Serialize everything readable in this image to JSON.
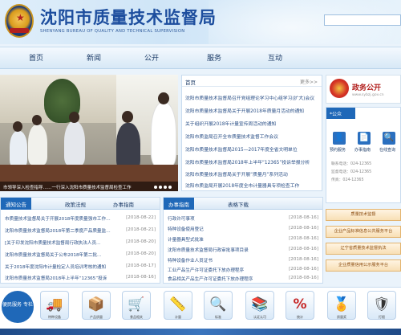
{
  "header": {
    "title": "沈阳市质量技术监督局",
    "subtitle": "SHENYANG  BUREAU OF QUALITY AND TECHNICAL SUPERVISION"
  },
  "nav": {
    "items": [
      "首页",
      "新闻",
      "公开",
      "服务",
      "互动"
    ]
  },
  "slideshow": {
    "caption": "市领导深入检查指导……一行深入沈阳市质量技术监督局检查工作"
  },
  "news": {
    "header": "首页",
    "more": "更多>>",
    "items": [
      "沈阳市质量技术监督局召开党组理论学习中心组学习(扩大)会议",
      "沈阳市质量技术监督局关于开展2018年质量月活动的通知",
      "关于组织开展2018年计量宣传周活动的通知",
      "沈阳市质监局召开全市质量技术监督工作会议",
      "沈阳市质量技术监督局2015—2017年度全省文明单位",
      "沈阳市质量技术监督局2018年上半年“12365”投诉举报分析",
      "沈阳市质量技术监督局关于开展“质量月”系列活动",
      "沈阳市质监局开展2018年度全市计量器具专项检查工作"
    ]
  },
  "gov": {
    "title": "政务公开",
    "url": "www.sybzj.gov.cn"
  },
  "services": {
    "tab": "*公众",
    "items": [
      {
        "icon": "person-icon",
        "label": "预约服务"
      },
      {
        "icon": "document-icon",
        "label": "办事指南"
      },
      {
        "icon": "search-icon",
        "label": "在线查询"
      }
    ],
    "info": [
      "联系电话：024-12365",
      "监督电话：024-12365",
      "传真：024-12365"
    ]
  },
  "tabs_left": {
    "tabs": [
      "通知公告",
      "政策法规",
      "办事指南"
    ],
    "rows": [
      {
        "text": "市质量技术监督局关于开展2018年度质量强市工作…",
        "date": "[2018-08-22]"
      },
      {
        "text": "沈阳市质量技术监督局2018年第二季度产品质量监…",
        "date": "[2018-08-21]"
      },
      {
        "text": "[关于印发沈阳市质量技术监督局行政执法人员…",
        "date": "[2018-08-20]"
      },
      {
        "text": "沈阳市质量技术监督局关于公布2018年第二批…",
        "date": "[2018-08-20]"
      },
      {
        "text": "关于2018年度沈阳市计量检定人员培训考核的通知",
        "date": "[2018-08-17]"
      },
      {
        "text": "沈阳市质量技术监督局2018年上半年“12365”投诉",
        "date": "[2018-08-16]"
      }
    ]
  },
  "tabs_mid": {
    "tabs": [
      "办事指南",
      "表格下载"
    ],
    "rows": [
      {
        "text": "行政许可事项",
        "date": "[2018-08-16]"
      },
      {
        "text": "特种设备使用登记",
        "date": "[2018-08-16]"
      },
      {
        "text": "计量器具型式批准",
        "date": "[2018-08-16]"
      },
      {
        "text": "沈阳市质量技术监督局行政审批事项目录",
        "date": "[2018-08-16]"
      },
      {
        "text": "特种设备作业人员证书",
        "date": "[2018-08-16]"
      },
      {
        "text": "工业产品生产许可证委托下放办理程序",
        "date": "[2018-08-16]"
      },
      {
        "text": "食品相关产品生产许可证委托下放办理程序",
        "date": "[2018-08-16]"
      }
    ]
  },
  "right_links": [
    "质量技术监督",
    "企业产品标准信息公共服务平台",
    "辽宁省质量技术监督执法",
    "企业质量信用公示服务平台"
  ],
  "strip": {
    "badge": "便民服务\n专栏",
    "items": [
      {
        "icon": "truck-icon",
        "glyph": "🚚",
        "label": "特种设备"
      },
      {
        "icon": "box-icon",
        "glyph": "📦",
        "label": "产品质量"
      },
      {
        "icon": "cart-icon",
        "glyph": "🛒",
        "label": "食品相关"
      },
      {
        "icon": "ruler-icon",
        "glyph": "📏",
        "label": "计量"
      },
      {
        "icon": "magnifier-icon",
        "glyph": "🔍",
        "label": "标准"
      },
      {
        "icon": "book-icon",
        "glyph": "📚",
        "label": "认证认可"
      },
      {
        "icon": "percent-icon",
        "glyph": "%",
        "label": "统计"
      },
      {
        "icon": "medal-icon",
        "glyph": "🏅",
        "label": "质量奖"
      },
      {
        "icon": "shield-icon",
        "glyph": "🛡",
        "label": "打假"
      }
    ]
  }
}
